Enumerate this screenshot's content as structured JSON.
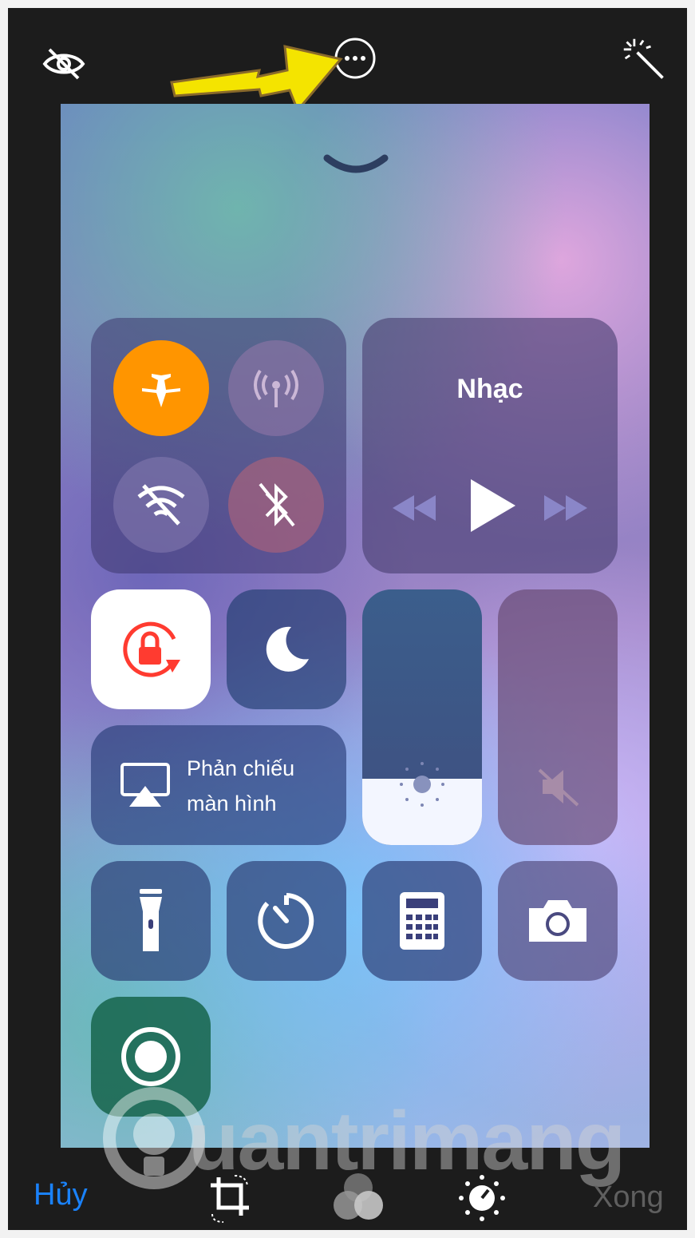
{
  "topbar": {
    "hide_icon": "eye-slash-icon",
    "more_icon": "ellipsis-circle-icon",
    "enhance_icon": "magic-wand-icon",
    "arrow_color": "#f4e400"
  },
  "control_center": {
    "grabber_icon": "chevron-down-icon",
    "connectivity": {
      "airplane": {
        "icon": "airplane-icon",
        "active": true,
        "color": "#ff9500"
      },
      "cellular": {
        "icon": "antenna-icon",
        "active": false
      },
      "wifi": {
        "icon": "wifi-off-icon",
        "active": false
      },
      "bluetooth": {
        "icon": "bluetooth-off-icon",
        "active": false
      }
    },
    "music": {
      "title": "Nhạc",
      "controls": [
        "rewind-icon",
        "play-icon",
        "fast-forward-icon"
      ]
    },
    "rotation_lock": {
      "icon": "rotation-lock-icon",
      "active": true,
      "color": "#ff3b30"
    },
    "do_not_disturb": {
      "icon": "moon-icon"
    },
    "screen_mirroring": {
      "icon": "airplay-icon",
      "label_line1": "Phản chiếu",
      "label_line2": "màn hình"
    },
    "brightness": {
      "icon": "sun-icon",
      "level": 0.26
    },
    "volume": {
      "icon": "speaker-mute-icon",
      "level": 0.0
    },
    "shortcuts": [
      "flashlight-icon",
      "timer-icon",
      "calculator-icon",
      "camera-icon"
    ],
    "screen_record": {
      "icon": "record-icon",
      "color": "#2f8a5a"
    }
  },
  "watermark": {
    "text": "uantrimang",
    "icon": "lightbulb-icon"
  },
  "bottombar": {
    "cancel_label": "Hủy",
    "done_label": "Xong",
    "cancel_color": "#1a82fb",
    "tools": [
      "crop-rotate-icon",
      "filters-icon",
      "adjust-icon"
    ]
  }
}
